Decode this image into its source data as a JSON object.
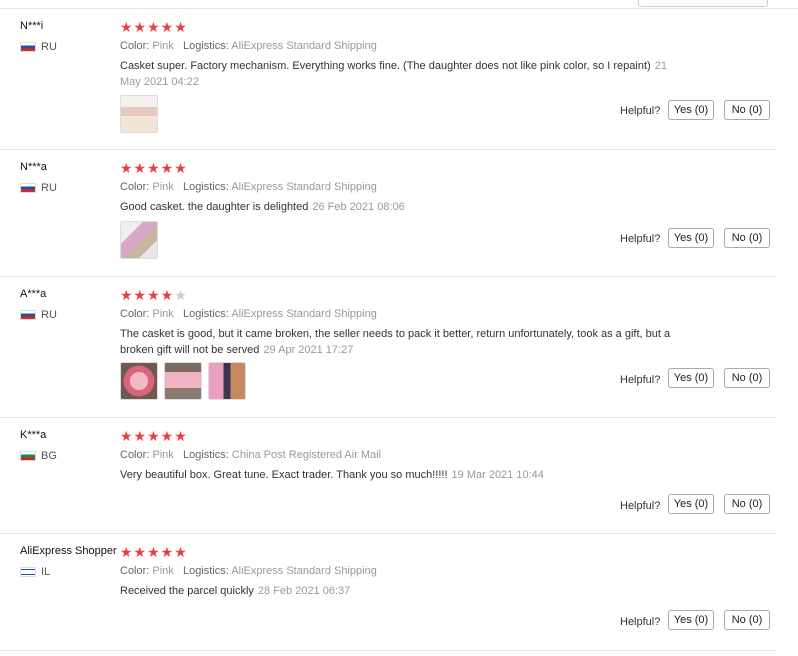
{
  "reviews": [
    {
      "user": "N***i",
      "country": "RU",
      "stars": "★★★★★",
      "stars_off": "",
      "color_label": "Color:",
      "color": "Pink",
      "logistics_label": "Logistics:",
      "logistics": "AliExpress Standard Shipping",
      "text": "Casket super. Factory mechanism. Everything works fine. (The daughter does not like pink color, so I repaint)",
      "date": "21 May 2021 04:22",
      "helpful": "Helpful?",
      "yes": "Yes (0)",
      "no": "No (0)"
    },
    {
      "user": "N***a",
      "country": "RU",
      "stars": "★★★★★",
      "stars_off": "",
      "color_label": "Color:",
      "color": "Pink",
      "logistics_label": "Logistics:",
      "logistics": "AliExpress Standard Shipping",
      "text": "Good casket. the daughter is delighted",
      "date": "26 Feb 2021 08:06",
      "helpful": "Helpful?",
      "yes": "Yes (0)",
      "no": "No (0)"
    },
    {
      "user": "A***a",
      "country": "RU",
      "stars": "★★★★",
      "stars_off": "★",
      "color_label": "Color:",
      "color": "Pink",
      "logistics_label": "Logistics:",
      "logistics": "AliExpress Standard Shipping",
      "text": "The casket is good, but it came broken, the seller needs to pack it better, return unfortunately, took as a gift, but a broken gift will not be served",
      "date": "29 Apr 2021 17:27",
      "helpful": "Helpful?",
      "yes": "Yes (0)",
      "no": "No (0)"
    },
    {
      "user": "K***a",
      "country": "BG",
      "stars": "★★★★★",
      "stars_off": "",
      "color_label": "Color:",
      "color": "Pink",
      "logistics_label": "Logistics:",
      "logistics": "China Post Registered Air Mail",
      "text": "Very beautiful box. Great tune. Exact trader. Thank you so much!!!!!",
      "date": "19 Mar 2021 10:44",
      "helpful": "Helpful?",
      "yes": "Yes (0)",
      "no": "No (0)"
    },
    {
      "user": "AliExpress Shopper",
      "country": "IL",
      "stars": "★★★★★",
      "stars_off": "",
      "color_label": "Color:",
      "color": "Pink",
      "logistics_label": "Logistics:",
      "logistics": "AliExpress Standard Shipping",
      "text": "Received the parcel quickly",
      "date": "28 Feb 2021 06:37",
      "helpful": "Helpful?",
      "yes": "Yes (0)",
      "no": "No (0)"
    }
  ],
  "colors": {
    "star": "#e8413d",
    "star_off": "#cccccc"
  }
}
